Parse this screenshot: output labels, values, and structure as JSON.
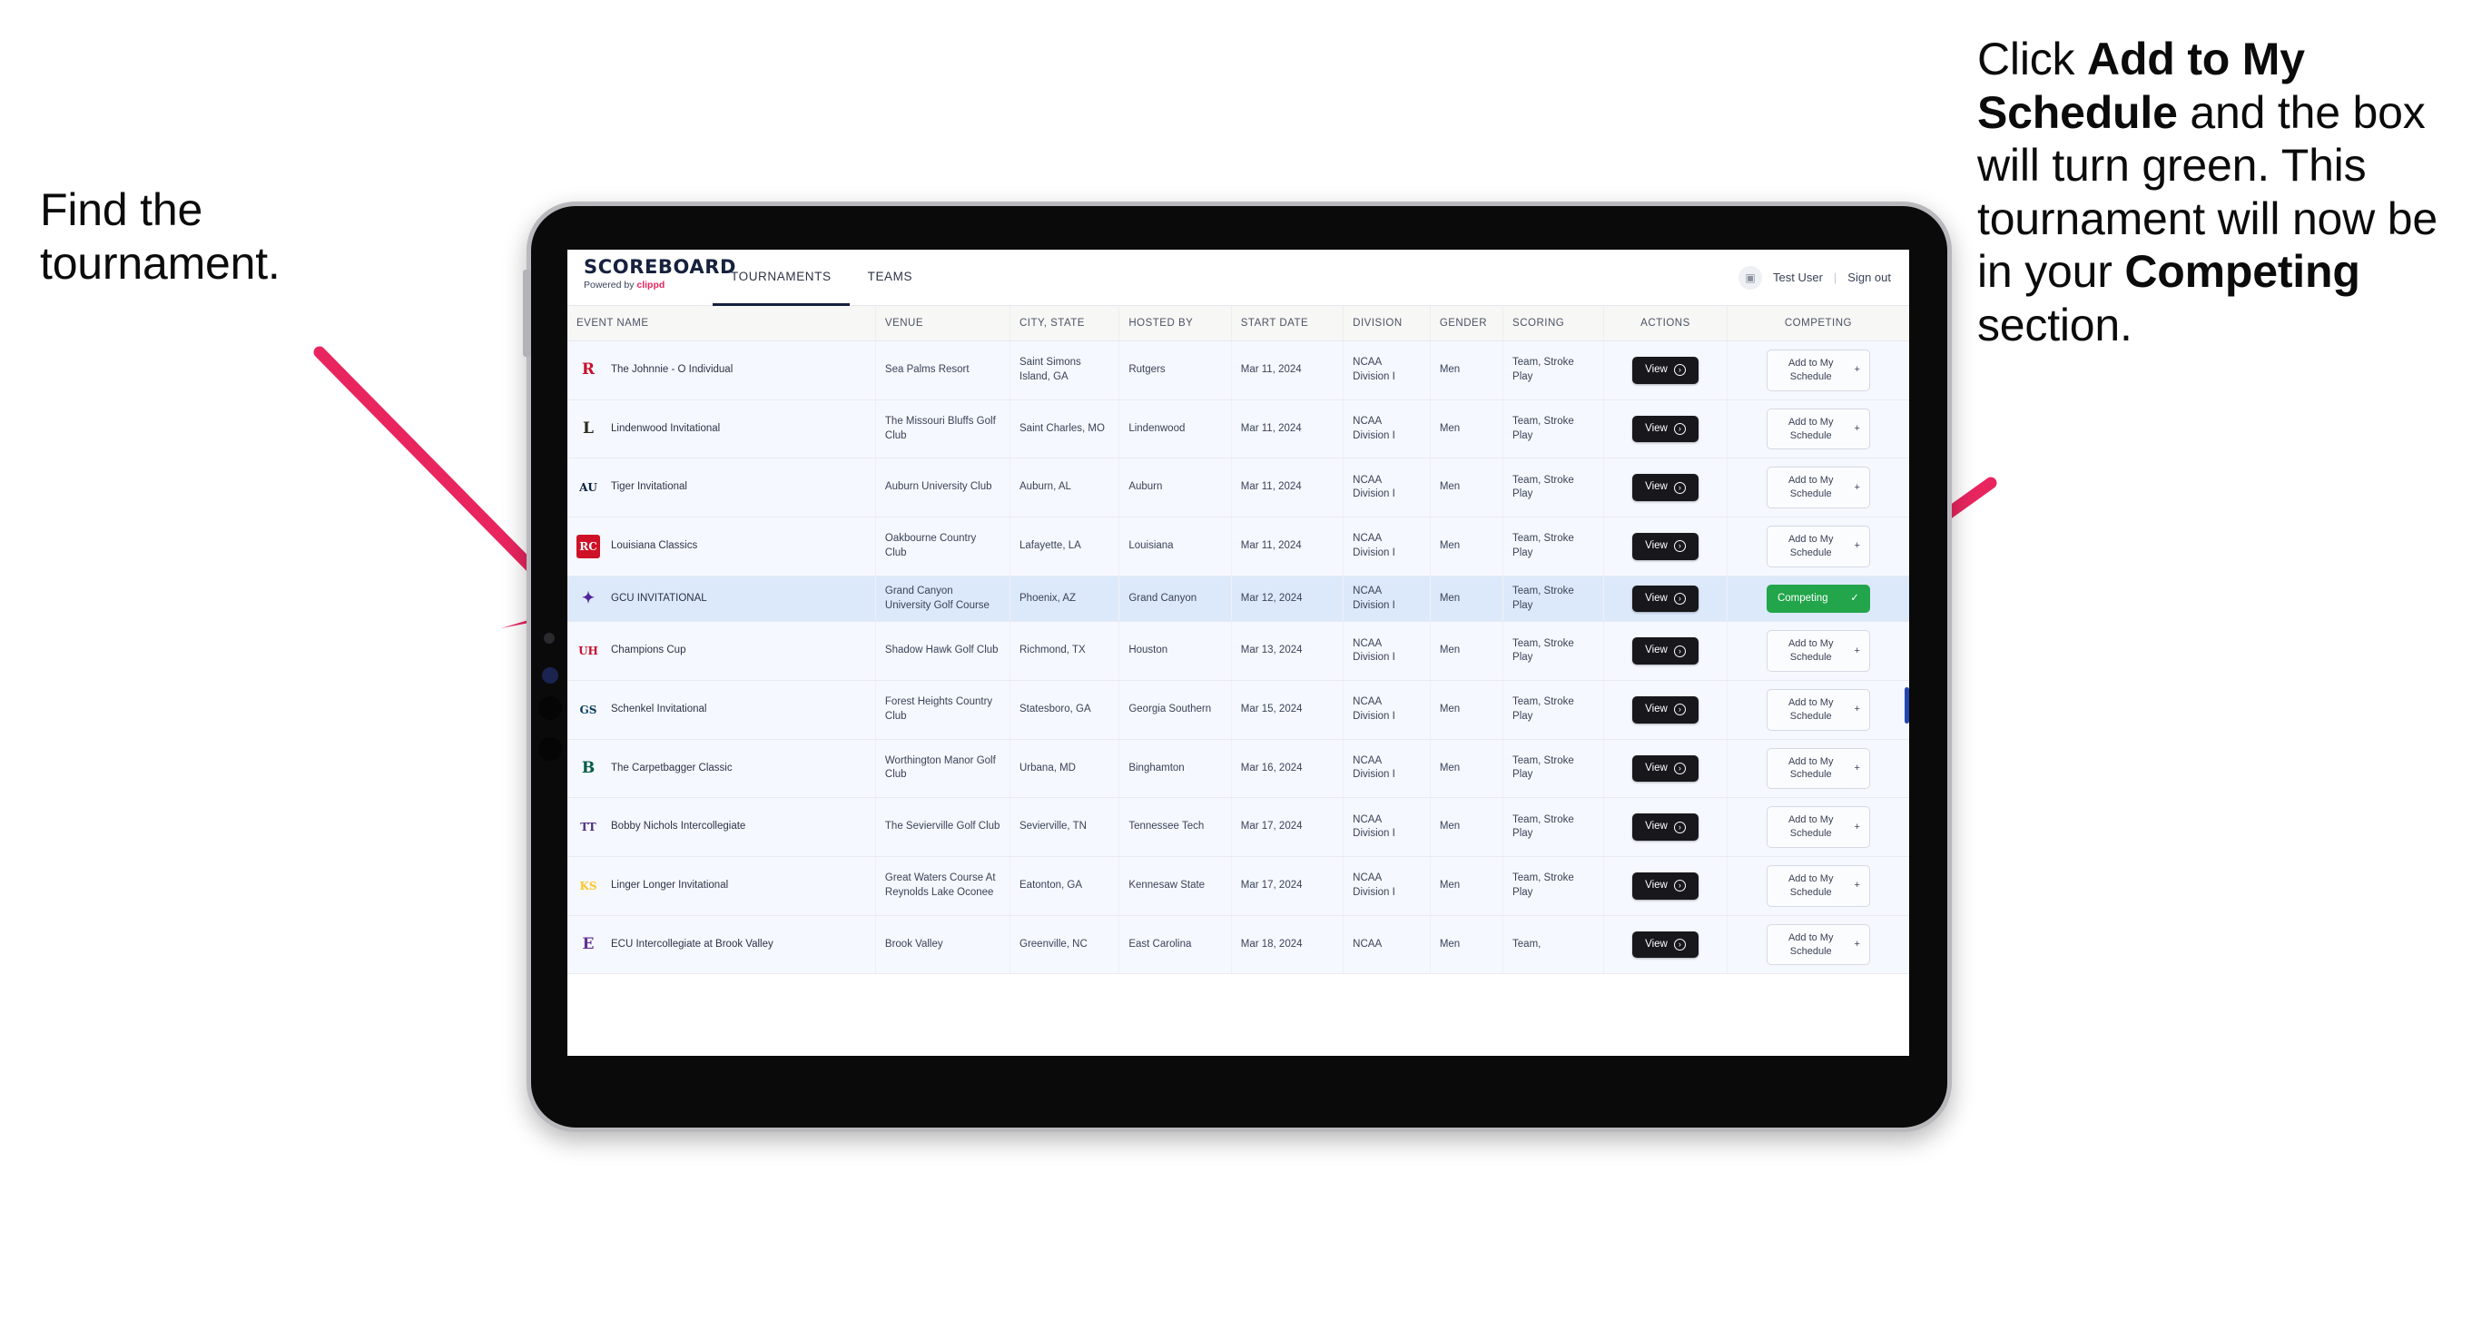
{
  "annotations": {
    "left": {
      "line1": "Find the",
      "line2": "tournament."
    },
    "right": {
      "pre": "Click ",
      "bold1": "Add to My Schedule",
      "mid": " and the box will turn green. This tournament will now be in your ",
      "bold2": "Competing",
      "post": " section."
    }
  },
  "colors": {
    "arrow": "#e8255f",
    "accent_green": "#22a54b",
    "brand_red": "#e8255f",
    "selected_row": "#dce9fb",
    "dark": "#17171c"
  },
  "app": {
    "brand": {
      "title": "SCOREBOARD",
      "powered_prefix": "Powered by ",
      "powered_brand": "clippd"
    },
    "tabs": [
      {
        "label": "TOURNAMENTS",
        "active": true
      },
      {
        "label": "TEAMS",
        "active": false
      }
    ],
    "header_right": {
      "avatar_icon": "user-avatar-icon",
      "user": "Test User",
      "separator": "|",
      "signout": "Sign out"
    },
    "table": {
      "columns": [
        "EVENT NAME",
        "VENUE",
        "CITY, STATE",
        "HOSTED BY",
        "START DATE",
        "DIVISION",
        "GENDER",
        "SCORING",
        "ACTIONS",
        "COMPETING"
      ],
      "view_label": "View",
      "add_label": "Add to My Schedule",
      "add_plus": "+",
      "competing_label": "Competing",
      "competing_check": "✓",
      "rows": [
        {
          "logo": {
            "text": "R",
            "fg": "#c8102e",
            "bg": "transparent"
          },
          "event": "The Johnnie - O Individual",
          "venue": "Sea Palms Resort",
          "city": "Saint Simons Island, GA",
          "host": "Rutgers",
          "date": "Mar 11, 2024",
          "division": "NCAA Division I",
          "gender": "Men",
          "scoring": "Team, Stroke Play",
          "competing": false
        },
        {
          "logo": {
            "text": "L",
            "fg": "#2b2b1f",
            "bg": "transparent"
          },
          "event": "Lindenwood Invitational",
          "venue": "The Missouri Bluffs Golf Club",
          "city": "Saint Charles, MO",
          "host": "Lindenwood",
          "date": "Mar 11, 2024",
          "division": "NCAA Division I",
          "gender": "Men",
          "scoring": "Team, Stroke Play",
          "competing": false
        },
        {
          "logo": {
            "text": "AU",
            "fg": "#0c2340",
            "bg": "transparent"
          },
          "event": "Tiger Invitational",
          "venue": "Auburn University Club",
          "city": "Auburn, AL",
          "host": "Auburn",
          "date": "Mar 11, 2024",
          "division": "NCAA Division I",
          "gender": "Men",
          "scoring": "Team, Stroke Play",
          "competing": false
        },
        {
          "logo": {
            "text": "RC",
            "fg": "#ffffff",
            "bg": "#ce1126"
          },
          "event": "Louisiana Classics",
          "venue": "Oakbourne Country Club",
          "city": "Lafayette, LA",
          "host": "Louisiana",
          "date": "Mar 11, 2024",
          "division": "NCAA Division I",
          "gender": "Men",
          "scoring": "Team, Stroke Play",
          "competing": false
        },
        {
          "logo": {
            "text": "✦",
            "fg": "#522398",
            "bg": "transparent"
          },
          "event": "GCU INVITATIONAL",
          "venue": "Grand Canyon University Golf Course",
          "city": "Phoenix, AZ",
          "host": "Grand Canyon",
          "date": "Mar 12, 2024",
          "division": "NCAA Division I",
          "gender": "Men",
          "scoring": "Team, Stroke Play",
          "competing": true
        },
        {
          "logo": {
            "text": "UH",
            "fg": "#c8102e",
            "bg": "transparent"
          },
          "event": "Champions Cup",
          "venue": "Shadow Hawk Golf Club",
          "city": "Richmond, TX",
          "host": "Houston",
          "date": "Mar 13, 2024",
          "division": "NCAA Division I",
          "gender": "Men",
          "scoring": "Team, Stroke Play",
          "competing": false
        },
        {
          "logo": {
            "text": "GS",
            "fg": "#0b3d5c",
            "bg": "transparent"
          },
          "event": "Schenkel Invitational",
          "venue": "Forest Heights Country Club",
          "city": "Statesboro, GA",
          "host": "Georgia Southern",
          "date": "Mar 15, 2024",
          "division": "NCAA Division I",
          "gender": "Men",
          "scoring": "Team, Stroke Play",
          "competing": false
        },
        {
          "logo": {
            "text": "B",
            "fg": "#005a43",
            "bg": "transparent"
          },
          "event": "The Carpetbagger Classic",
          "venue": "Worthington Manor Golf Club",
          "city": "Urbana, MD",
          "host": "Binghamton",
          "date": "Mar 16, 2024",
          "division": "NCAA Division I",
          "gender": "Men",
          "scoring": "Team, Stroke Play",
          "competing": false
        },
        {
          "logo": {
            "text": "TT",
            "fg": "#4b2e83",
            "bg": "transparent"
          },
          "event": "Bobby Nichols Intercollegiate",
          "venue": "The Sevierville Golf Club",
          "city": "Sevierville, TN",
          "host": "Tennessee Tech",
          "date": "Mar 17, 2024",
          "division": "NCAA Division I",
          "gender": "Men",
          "scoring": "Team, Stroke Play",
          "competing": false
        },
        {
          "logo": {
            "text": "KS",
            "fg": "#ffc629",
            "bg": "transparent"
          },
          "event": "Linger Longer Invitational",
          "venue": "Great Waters Course At Reynolds Lake Oconee",
          "city": "Eatonton, GA",
          "host": "Kennesaw State",
          "date": "Mar 17, 2024",
          "division": "NCAA Division I",
          "gender": "Men",
          "scoring": "Team, Stroke Play",
          "competing": false
        },
        {
          "logo": {
            "text": "E",
            "fg": "#63318e",
            "bg": "transparent"
          },
          "event": "ECU Intercollegiate at Brook Valley",
          "venue": "Brook Valley",
          "city": "Greenville, NC",
          "host": "East Carolina",
          "date": "Mar 18, 2024",
          "division": "NCAA",
          "gender": "Men",
          "scoring": "Team,",
          "competing": false
        }
      ]
    }
  }
}
